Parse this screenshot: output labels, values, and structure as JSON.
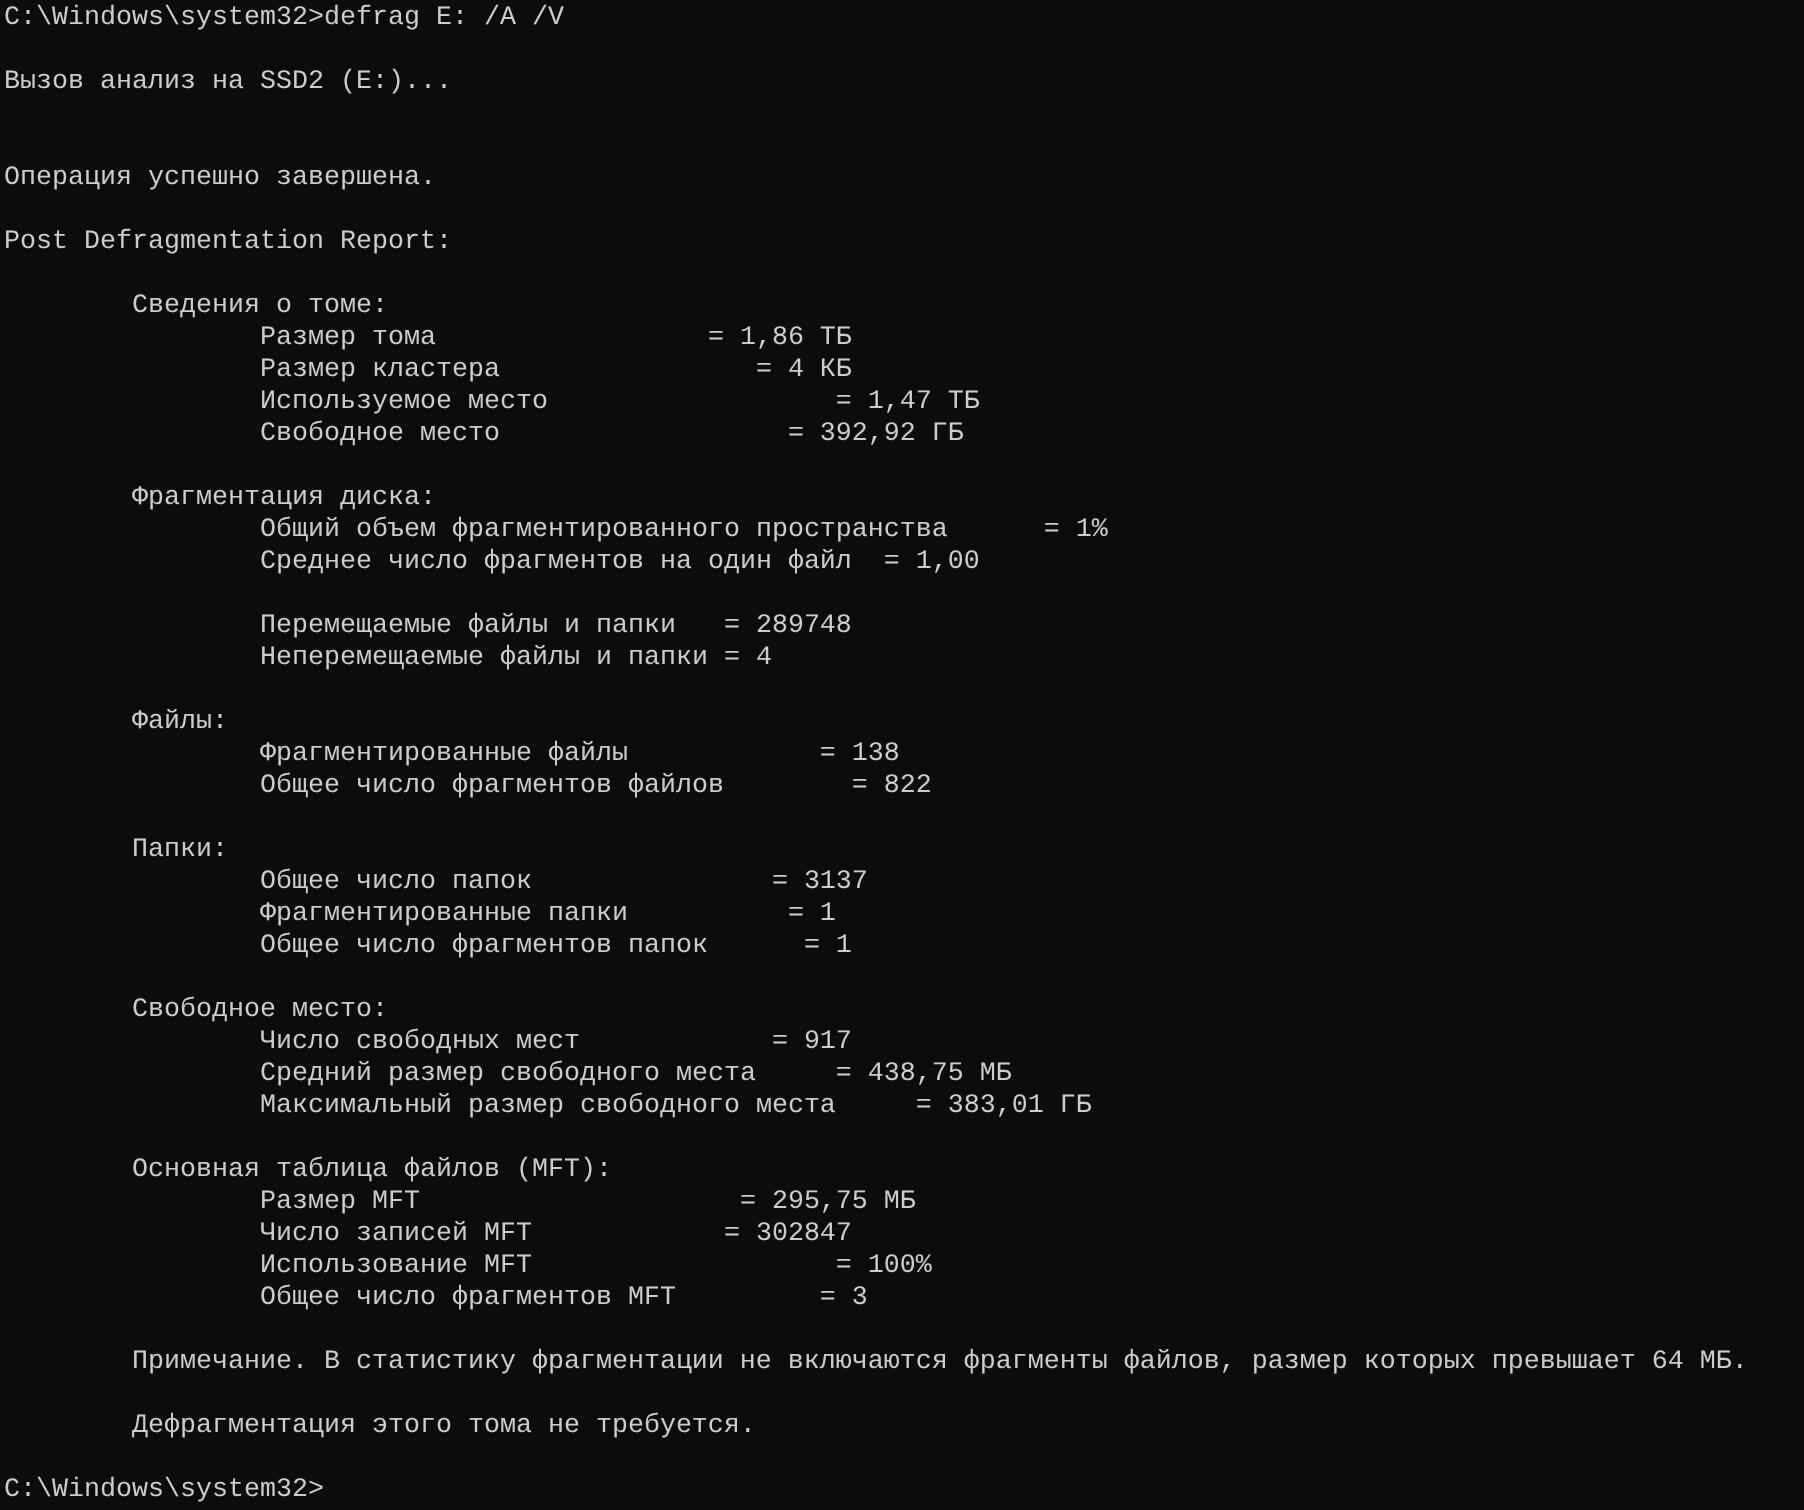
{
  "console": {
    "command": "C:\\Windows\\system32>defrag E: /A /V",
    "messages": [
      "Вызов анализ на SSD2 (E:)...",
      "Операция успешно завершена."
    ],
    "report_title": "Post Defragmentation Report:",
    "sections": [
      {
        "heading": "Сведения о томе:",
        "groups": [
          {
            "lines": [
              "Размер тома                 = 1,86 ТБ",
              "Размер кластера                = 4 КБ",
              "Используемое место                  = 1,47 ТБ",
              "Свободное место                  = 392,92 ГБ"
            ]
          }
        ]
      },
      {
        "heading": "Фрагментация диска:",
        "groups": [
          {
            "lines": [
              "Общий объем фрагментированного пространства      = 1%",
              "Среднее число фрагментов на один файл  = 1,00"
            ]
          },
          {
            "lines": [
              "Перемещаемые файлы и папки   = 289748",
              "Неперемещаемые файлы и папки = 4"
            ]
          }
        ]
      },
      {
        "heading": "Файлы:",
        "groups": [
          {
            "lines": [
              "Фрагментированные файлы            = 138",
              "Общее число фрагментов файлов        = 822"
            ]
          }
        ]
      },
      {
        "heading": "Папки:",
        "groups": [
          {
            "lines": [
              "Общее число папок               = 3137",
              "Фрагментированные папки          = 1",
              "Общее число фрагментов папок      = 1"
            ]
          }
        ]
      },
      {
        "heading": "Свободное место:",
        "groups": [
          {
            "lines": [
              "Число свободных мест            = 917",
              "Средний размер свободного места     = 438,75 МБ",
              "Максимальный размер свободного места     = 383,01 ГБ"
            ]
          }
        ]
      },
      {
        "heading": "Основная таблица файлов (MFT):",
        "groups": [
          {
            "lines": [
              "Размер MFT                    = 295,75 МБ",
              "Число записей MFT            = 302847",
              "Использование MFT                   = 100%",
              "Общее число фрагментов MFT         = 3"
            ]
          }
        ]
      }
    ],
    "notes": [
      "Примечание. В статистику фрагментации не включаются фрагменты файлов, размер которых превышает 64 МБ.",
      "Дефрагментация этого тома не требуется."
    ],
    "prompt": "C:\\Windows\\system32>"
  }
}
